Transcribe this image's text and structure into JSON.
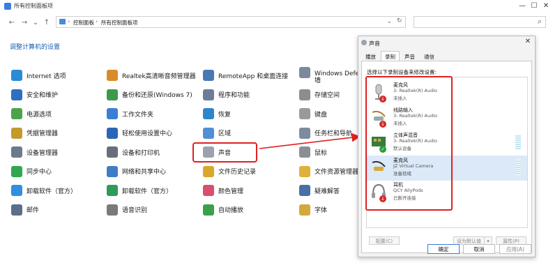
{
  "window": {
    "title": "所有控制面板项",
    "controls": {
      "minimize": "—",
      "maximize": "☐",
      "close": "✕"
    }
  },
  "nav": {
    "back": "←",
    "forward": "→",
    "down": "⌄",
    "up": "↑",
    "breadcrumb": [
      "控制面板",
      "所有控制面板项"
    ],
    "refresh": "↻",
    "search_icon": "⌕"
  },
  "heading": "调整计算机的设置",
  "columns": [
    [
      {
        "name": "internet-options",
        "label": "Internet 选项",
        "color": "#2a8bd6"
      },
      {
        "name": "security-maintenance",
        "label": "安全和维护",
        "color": "#2f6fc1"
      },
      {
        "name": "power-options",
        "label": "电源选项",
        "color": "#4aa34a"
      },
      {
        "name": "credential-manager",
        "label": "凭据管理器",
        "color": "#c49a2f"
      },
      {
        "name": "device-manager",
        "label": "设备管理器",
        "color": "#6b7b8c"
      },
      {
        "name": "sync-center",
        "label": "同步中心",
        "color": "#2fa84f"
      },
      {
        "name": "uninstall-software",
        "label": "卸载软件（官方）",
        "color": "#2f8fe0"
      },
      {
        "name": "mail",
        "label": "邮件",
        "color": "#5a6f8a"
      }
    ],
    [
      {
        "name": "realtek-audio-manager",
        "label": "Realtek高清晰音频管理器",
        "color": "#d98b2b"
      },
      {
        "name": "backup-restore",
        "label": "备份和还原(Windows 7)",
        "color": "#3c9a4a"
      },
      {
        "name": "work-folders",
        "label": "工作文件夹",
        "color": "#3a7fd6"
      },
      {
        "name": "ease-of-access",
        "label": "轻松使用设置中心",
        "color": "#2b65b8"
      },
      {
        "name": "devices-printers",
        "label": "设备和打印机",
        "color": "#666f7a"
      },
      {
        "name": "network-sharing",
        "label": "网络和共享中心",
        "color": "#3f7dc9"
      },
      {
        "name": "uninstall-software-2",
        "label": "卸载软件（官方）",
        "color": "#2f9a5a"
      },
      {
        "name": "speech-recognition",
        "label": "语音识别",
        "color": "#7a7a7a"
      }
    ],
    [
      {
        "name": "remoteapp",
        "label": "RemoteApp 和桌面连接",
        "color": "#4a78b5"
      },
      {
        "name": "programs-features",
        "label": "程序和功能",
        "color": "#6b7d99"
      },
      {
        "name": "recovery",
        "label": "恢复",
        "color": "#2e86c9"
      },
      {
        "name": "region",
        "label": "区域",
        "color": "#4f8fd6"
      },
      {
        "name": "sound",
        "label": "声音",
        "color": "#9aa3ad"
      },
      {
        "name": "file-history",
        "label": "文件历史记录",
        "color": "#d9a82b"
      },
      {
        "name": "color-management",
        "label": "颜色管理",
        "color": "#d94f6f"
      },
      {
        "name": "autoplay",
        "label": "自动播放",
        "color": "#3aa04a"
      }
    ],
    [
      {
        "name": "windows-defender",
        "label": "Windows Defe",
        "label2": "墙",
        "color": "#7a8a9a"
      },
      {
        "name": "storage-spaces",
        "label": "存储空间",
        "color": "#8d8d8d"
      },
      {
        "name": "keyboard",
        "label": "键盘",
        "color": "#9a9a9a"
      },
      {
        "name": "taskbar-navigation",
        "label": "任务栏和导航",
        "color": "#7d8c9c"
      },
      {
        "name": "mouse",
        "label": "鼠标",
        "color": "#8a8f96"
      },
      {
        "name": "file-explorer-options",
        "label": "文件资源管理器",
        "color": "#e0b13a"
      },
      {
        "name": "troubleshooting",
        "label": "疑难解答",
        "color": "#4a6fa5"
      },
      {
        "name": "fonts",
        "label": "字体",
        "color": "#d4a83a"
      }
    ]
  ],
  "dialog": {
    "title": "声音",
    "close": "✕",
    "tabs": [
      "播放",
      "录制",
      "声音",
      "通信"
    ],
    "active_tab": 1,
    "instruction": "选择以下录制设备来修改设置:",
    "devices": [
      {
        "name": "麦克风",
        "driver": "3- Realtek(R) Audio",
        "status": "未插入",
        "badge": "down",
        "selected": false
      },
      {
        "name": "线路输入",
        "driver": "3- Realtek(R) Audio",
        "status": "未插入",
        "badge": "down",
        "selected": false
      },
      {
        "name": "立体声混音",
        "driver": "3- Realtek(R) Audio",
        "status": "默认设备",
        "badge": "check",
        "selected": false
      },
      {
        "name": "麦克风",
        "driver": "JZ Virtual Camera",
        "status": "准备就绪",
        "badge": "none",
        "selected": true
      },
      {
        "name": "耳机",
        "driver": "QCY AilyPods",
        "status": "已断开连接",
        "badge": "down",
        "selected": false
      }
    ],
    "buttons": {
      "configure": "配置(C)",
      "set_default": "设为默认值",
      "set_default_arrow": "▾",
      "properties": "属性(P)",
      "ok": "确定",
      "cancel": "取消",
      "apply": "应用(A)"
    },
    "badge_colors": {
      "down": "#d42a2a",
      "check": "#2a9d3e"
    }
  },
  "annotation_color": "#e02020"
}
